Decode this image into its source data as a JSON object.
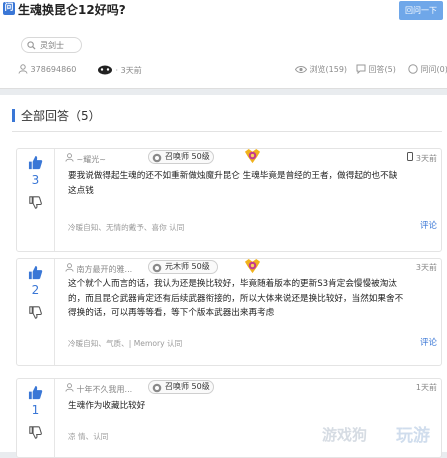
{
  "question": {
    "badge": "问",
    "title": "生魂换昆仑12好吗?",
    "ask_button": "回问一下",
    "tag": "灵剑士",
    "user_id": "378694860",
    "time": "· 3天前",
    "views": "浏览(159)",
    "answers": "回答(5)",
    "same_q": "同问(0)"
  },
  "section": {
    "title": "全部回答（5）"
  },
  "answers": [
    {
      "votes": "3",
      "user": "~耀光~",
      "rank": "召唤师 50级",
      "time": "3天前",
      "lines": [
        "要我说做得起生魂的还不如重新做烛魔升昆仑 生魂毕竟是曾经的王者，做得起的也不缺",
        "这点钱"
      ],
      "likes": "冷暖自知、无情的戴予、喜你 认同",
      "comment": "评论"
    },
    {
      "votes": "2",
      "user": "南方最开的雅...",
      "rank": "元木师 50级",
      "time": "3天前",
      "lines": [
        "这个就个人而言的话，我认为还是换比较好，毕竟随着版本的更新S3肯定会慢慢被淘汰",
        "的，而且昆仑武器肯定还有后续武器衔接的，所以大体来说还是换比较好，当然如果舍不",
        "得换的话，可以再等等看，等下个版本武器出来再考虑"
      ],
      "likes": "冷暖自知、气质、| Memory 认同",
      "comment": "评论"
    },
    {
      "votes": "1",
      "user": "十年不久我用...",
      "rank": "召唤师 50级",
      "time": "1天前",
      "lines": [
        "生魂作为收藏比较好"
      ],
      "likes": "凉 情、认同",
      "comment": "评论"
    }
  ],
  "watermark": {
    "left": "游戏狗",
    "right": "玩游"
  }
}
